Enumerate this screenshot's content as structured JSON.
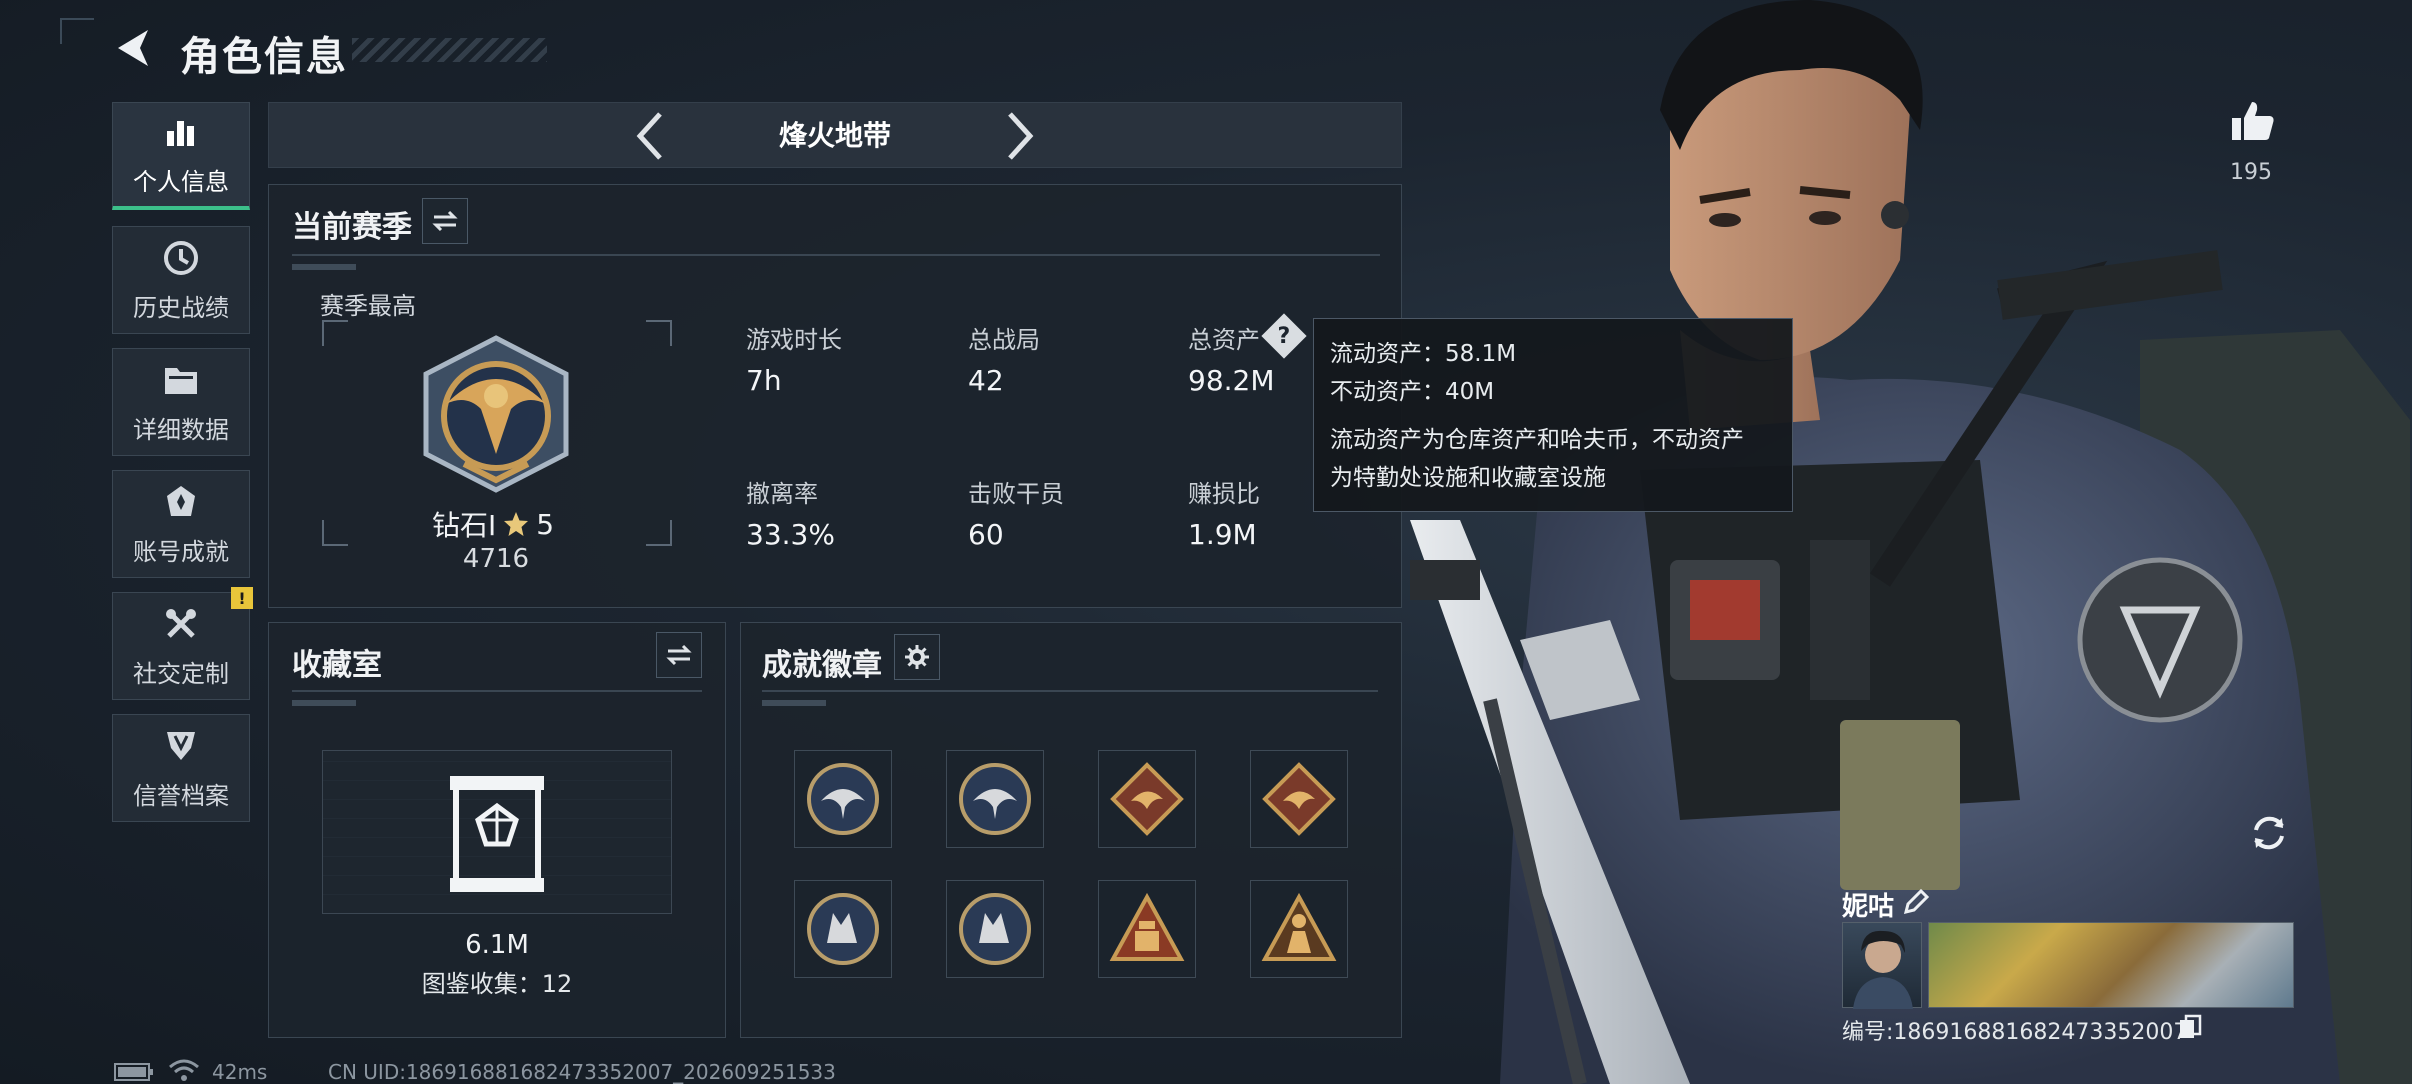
{
  "header": {
    "title": "角色信息"
  },
  "sidebar": {
    "items": [
      {
        "label": "个人信息",
        "icon": "bar-chart-icon",
        "active": true
      },
      {
        "label": "历史战绩",
        "icon": "clock-icon"
      },
      {
        "label": "详细数据",
        "icon": "folder-icon"
      },
      {
        "label": "账号成就",
        "icon": "achievement-icon"
      },
      {
        "label": "社交定制",
        "icon": "tools-icon",
        "alert": "!"
      },
      {
        "label": "信誉档案",
        "icon": "shield-emblem-icon"
      }
    ]
  },
  "mode_selector": {
    "label": "烽火地带"
  },
  "season": {
    "title": "当前赛季",
    "best_label": "赛季最高",
    "rank_name": "钻石Ⅰ",
    "rank_stars": "5",
    "rank_score": "4716",
    "stats": [
      {
        "label": "游戏时长",
        "value": "7h"
      },
      {
        "label": "总战局",
        "value": "42"
      },
      {
        "label": "总资产",
        "value": "98.2M"
      },
      {
        "label": "撤离率",
        "value": "33.3%"
      },
      {
        "label": "击败干员",
        "value": "60"
      },
      {
        "label": "赚损比",
        "value": "1.9M"
      }
    ]
  },
  "tooltip": {
    "line1": "流动资产：58.1M",
    "line2": "不动资产：40M",
    "desc1": "流动资产为仓库资产和哈夫币，不动资产",
    "desc2": "为特勤处设施和收藏室设施"
  },
  "collection": {
    "title": "收藏室",
    "value": "6.1M",
    "catalog": "图鉴收集：12"
  },
  "achievements": {
    "title": "成就徽章",
    "badges": [
      "eagle-badge-blue",
      "eagle-badge-blue",
      "dragon-badge-red",
      "dragon-badge-red",
      "wolf-badge-blue",
      "wolf-badge-blue",
      "pyramid-badge-red",
      "figure-badge-red"
    ]
  },
  "likes": {
    "count": "195"
  },
  "player": {
    "name": "妮咕",
    "id": "编号:186916881682473352007"
  },
  "status_bar": {
    "ping": "42ms",
    "uid": "CN UID:186916881682473352007_202609251533"
  },
  "colors": {
    "accent": "#3cc08a",
    "alert": "#e8c53a",
    "panel_bg": "#1c242d"
  }
}
